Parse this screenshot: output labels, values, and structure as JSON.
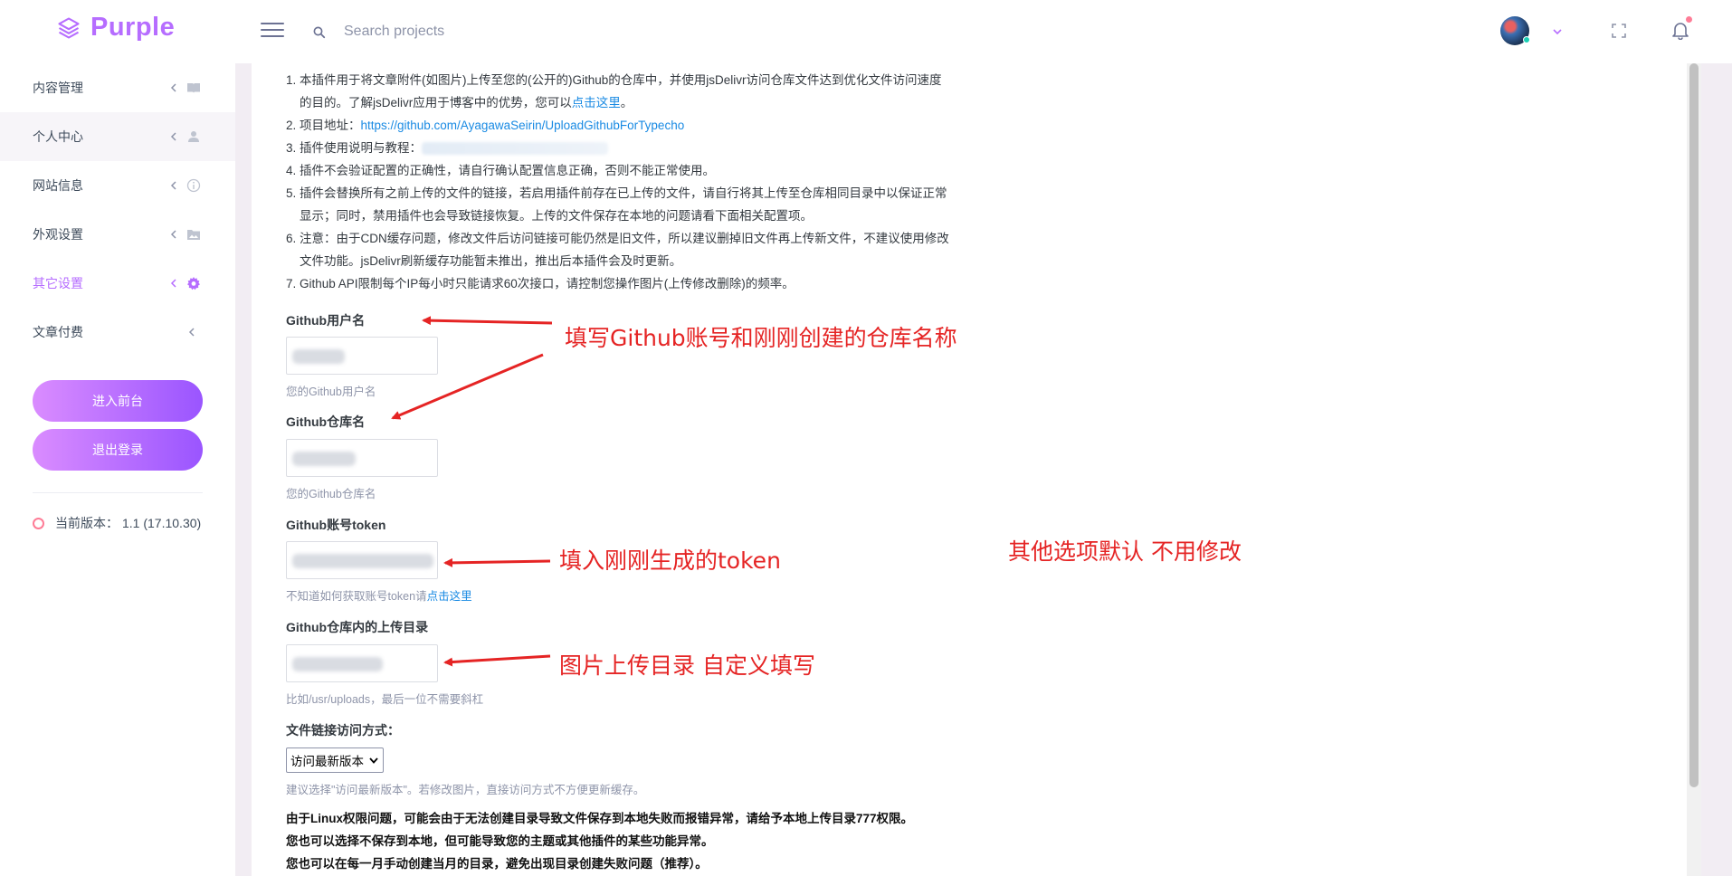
{
  "brand": {
    "name": "Purple"
  },
  "search": {
    "placeholder": "Search projects"
  },
  "sidebar": {
    "items": [
      {
        "label": "内容管理"
      },
      {
        "label": "个人中心"
      },
      {
        "label": "网站信息"
      },
      {
        "label": "外观设置"
      },
      {
        "label": "其它设置"
      },
      {
        "label": "文章付费"
      }
    ],
    "frontend_button": "进入前台",
    "logout_button": "退出登录",
    "version_label": "当前版本：",
    "version_value": "1.1 (17.10.30)"
  },
  "notes": [
    {
      "num": "1.",
      "line1": "本插件用于将文章附件(如图片)上传至您的(公开的)Github的仓库中，并使用jsDelivr访问仓库文件达到优化文件访问速度",
      "line2_prefix": "的目的。了解jsDelivr应用于博客中的优势，您可以",
      "line2_link": "点击这里",
      "line2_suffix": "。"
    },
    {
      "num": "2.",
      "prefix": "项目地址：",
      "link": "https://github.com/AyagawaSeirin/UploadGithubForTypecho"
    },
    {
      "num": "3.",
      "prefix": "插件使用说明与教程："
    },
    {
      "num": "4.",
      "text": "插件不会验证配置的正确性，请自行确认配置信息正确，否则不能正常使用。"
    },
    {
      "num": "5.",
      "line1": "插件会替换所有之前上传的文件的链接，若启用插件前存在已上传的文件，请自行将其上传至仓库相同目录中以保证正常",
      "line2": "显示；同时，禁用插件也会导致链接恢复。上传的文件保存在本地的问题请看下面相关配置项。"
    },
    {
      "num": "6.",
      "line1": "注意：由于CDN缓存问题，修改文件后访问链接可能仍然是旧文件，所以建议删掉旧文件再上传新文件，不建议使用修改",
      "line2": "文件功能。jsDelivr刷新缓存功能暂未推出，推出后本插件会及时更新。"
    },
    {
      "num": "7.",
      "text": "Github API限制每个IP每小时只能请求60次接口，请控制您操作图片(上传修改删除)的频率。"
    }
  ],
  "form": {
    "username_label": "Github用户名",
    "username_hint": "您的Github用户名",
    "repo_label": "Github仓库名",
    "repo_hint": "您的Github仓库名",
    "token_label": "Github账号token",
    "token_hint_prefix": "不知道如何获取账号token请",
    "token_hint_link": "点击这里",
    "dir_label": "Github仓库内的上传目录",
    "dir_hint": "比如/usr/uploads，最后一位不需要斜杠",
    "access_label": "文件链接访问方式：",
    "access_selected": "访问最新版本",
    "access_hint": "建议选择\"访问最新版本\"。若修改图片，直接访问方式不方便更新缓存。"
  },
  "warning": {
    "line1": "由于Linux权限问题，可能会由于无法创建目录导致文件保存到本地失败而报错异常，请给予本地上传目录777权限。",
    "line2": "您也可以选择不保存到本地，但可能导致您的主题或其他插件的某些功能异常。",
    "line3": "您也可以在每一月手动创建当月的目录，避免出现目录创建失败问题（推荐）。"
  },
  "annotations": {
    "account_repo": "填写Github账号和刚刚创建的仓库名称",
    "token": "填入刚刚生成的token",
    "directory": "图片上传目录 自定义填写",
    "others": "其他选项默认 不用修改"
  },
  "colors": {
    "brand": "#b66dff",
    "annotation": "#e52424",
    "link": "#198ae3",
    "button_gradient_start": "#da8cff",
    "button_gradient_end": "#9a55ff"
  },
  "icons": [
    "layers-icon",
    "menu-icon",
    "search-icon",
    "chevron-down-icon",
    "fullscreen-icon",
    "bell-icon",
    "book-icon",
    "user-icon",
    "info-icon",
    "image-icon",
    "gear-icon",
    "chevron-left-icon"
  ]
}
